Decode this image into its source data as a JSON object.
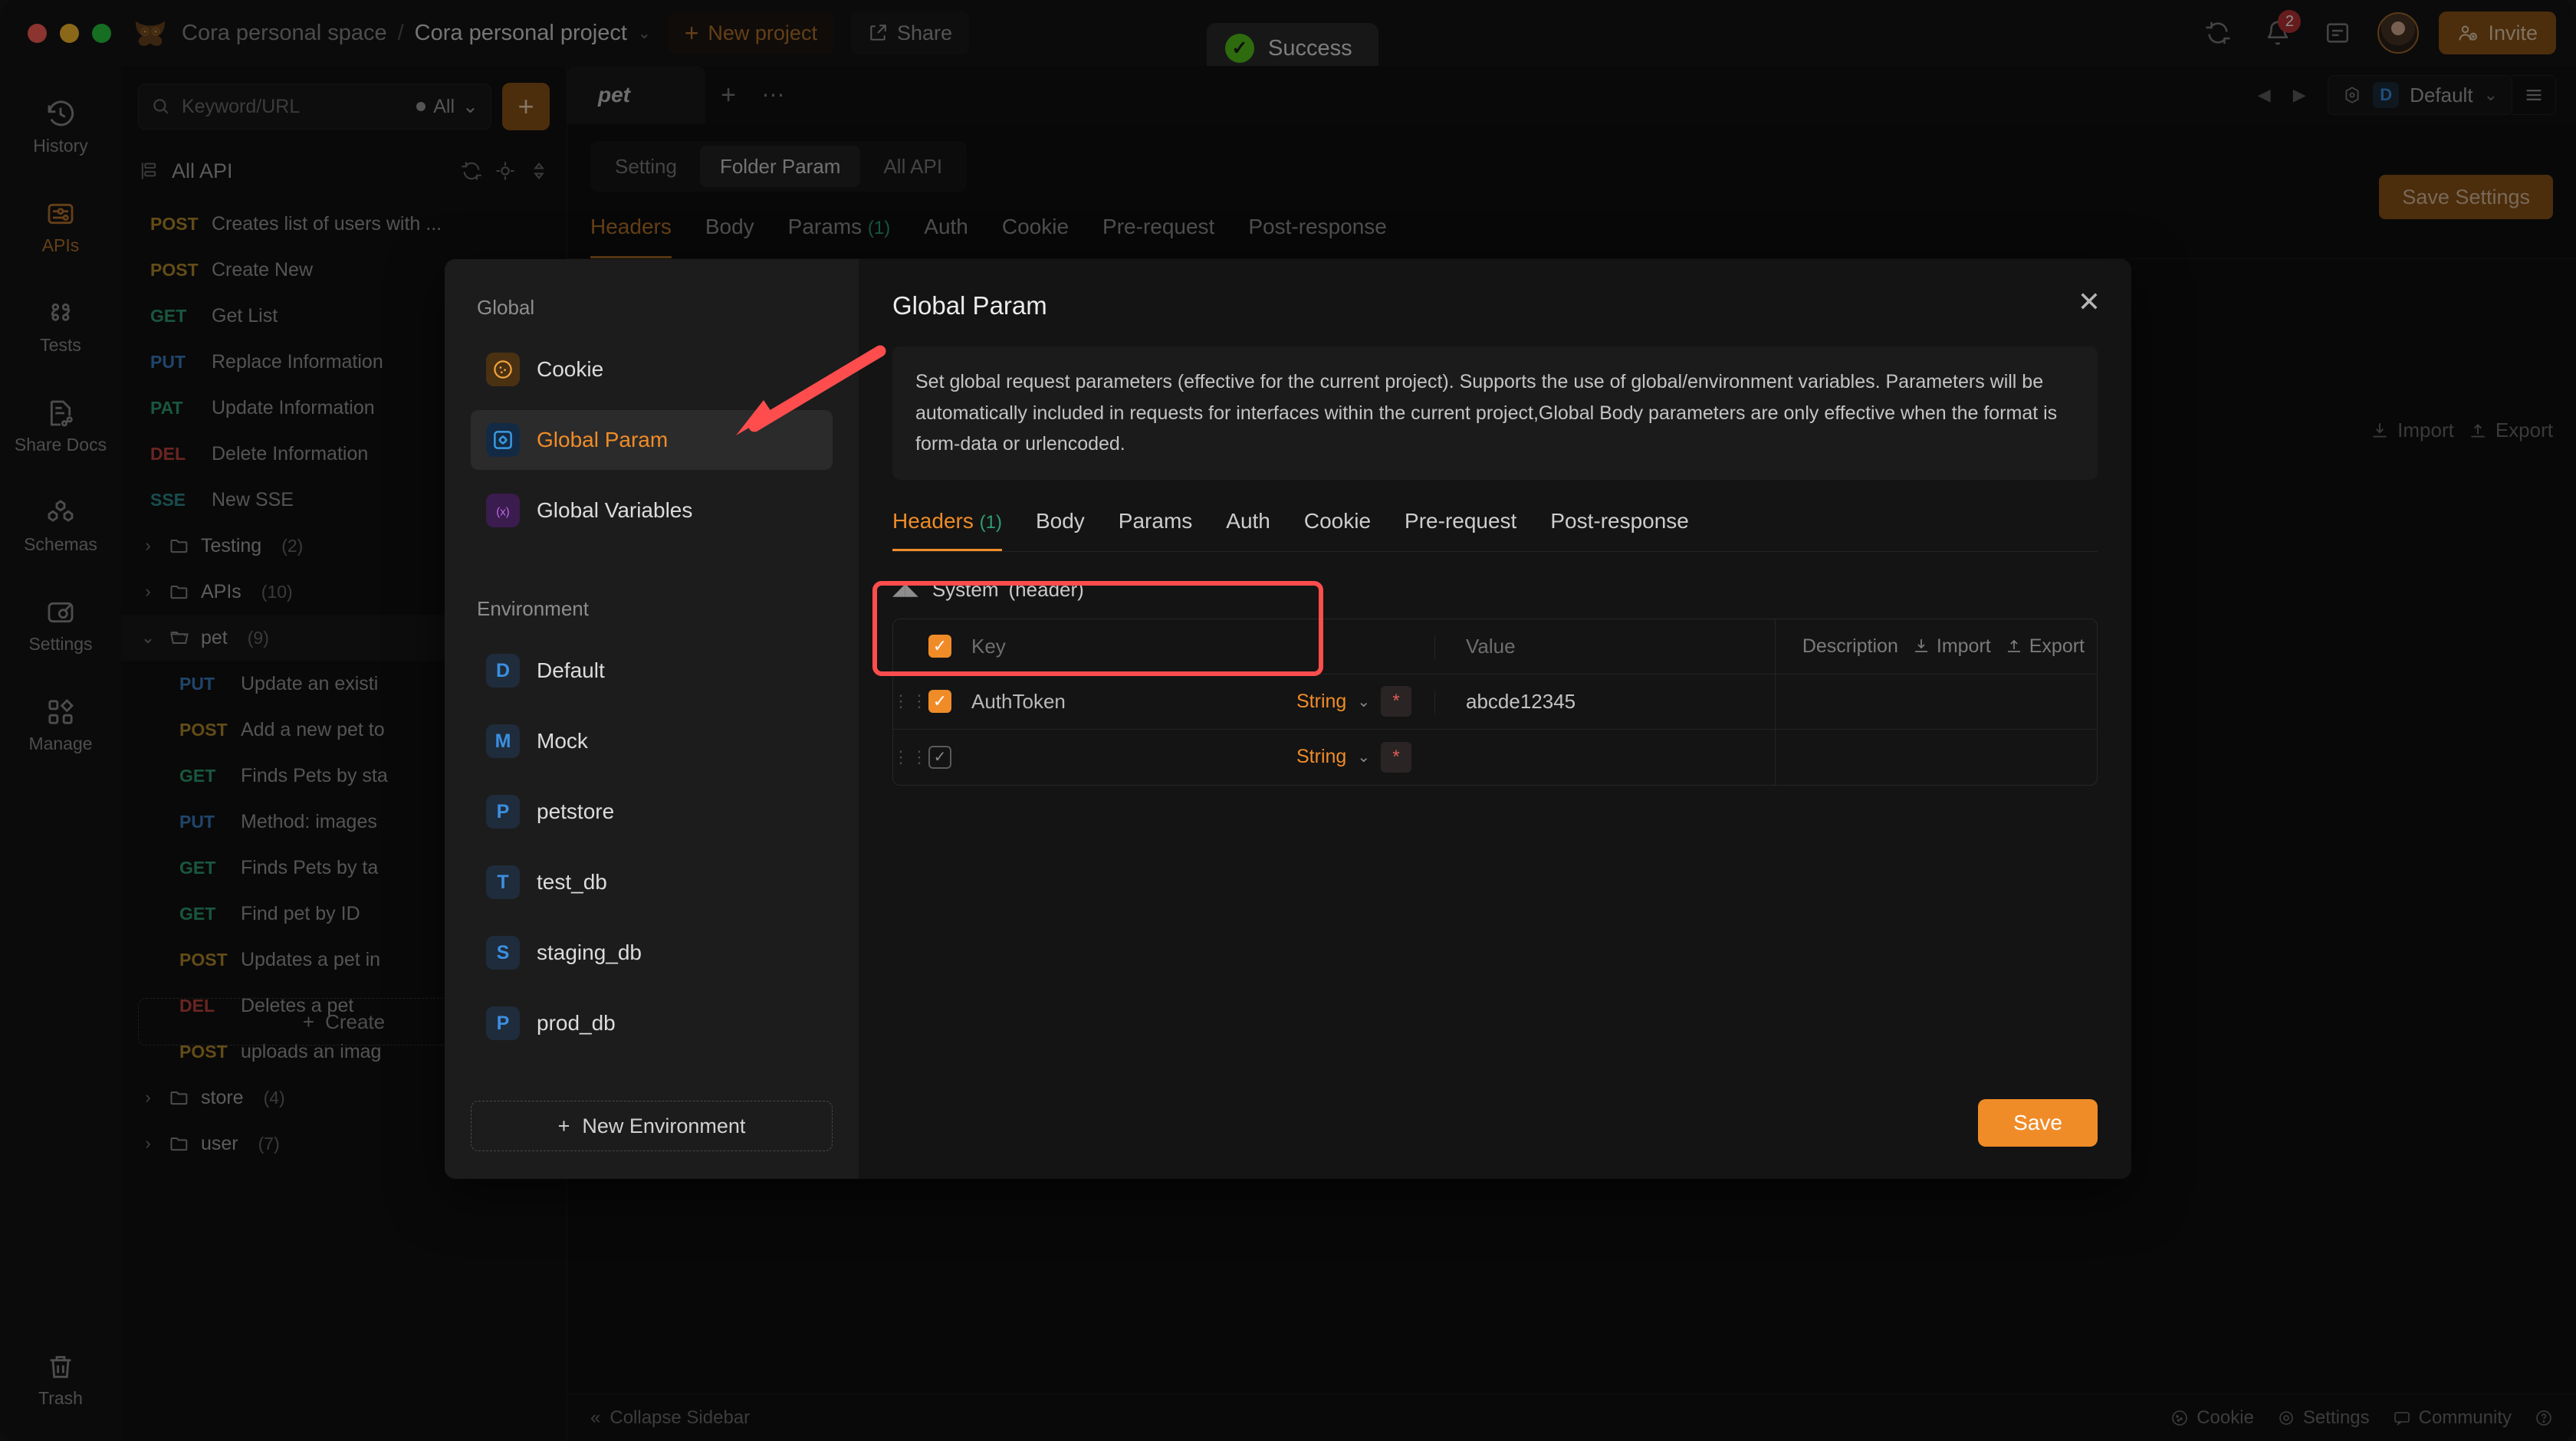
{
  "titlebar": {
    "space": "Cora personal space",
    "separator": "/",
    "project": "Cora personal project",
    "new_project": "New project",
    "share": "Share",
    "notification_count": "2",
    "invite": "Invite"
  },
  "toast": {
    "text": "Success"
  },
  "rail": {
    "items": [
      {
        "label": "History",
        "icon": "history-icon"
      },
      {
        "label": "APIs",
        "icon": "apis-icon"
      },
      {
        "label": "Tests",
        "icon": "tests-icon"
      },
      {
        "label": "Share Docs",
        "icon": "share-docs-icon"
      },
      {
        "label": "Schemas",
        "icon": "schemas-icon"
      },
      {
        "label": "Settings",
        "icon": "settings-icon"
      },
      {
        "label": "Manage",
        "icon": "manage-icon"
      }
    ],
    "trash": "Trash"
  },
  "list": {
    "search_placeholder": "Keyword/URL",
    "filter": "All",
    "add": "+",
    "all_api": "All API",
    "create": "Create",
    "rows": [
      {
        "kind": "api",
        "method": "POST",
        "mclass": "post",
        "name": "Creates list of users with ...",
        "indent": ""
      },
      {
        "kind": "api",
        "method": "POST",
        "mclass": "post",
        "name": "Create New",
        "indent": ""
      },
      {
        "kind": "api",
        "method": "GET",
        "mclass": "get",
        "name": "Get List",
        "indent": ""
      },
      {
        "kind": "api",
        "method": "PUT",
        "mclass": "put",
        "name": "Replace Information",
        "indent": ""
      },
      {
        "kind": "api",
        "method": "PAT",
        "mclass": "pat",
        "name": "Update Information",
        "indent": ""
      },
      {
        "kind": "api",
        "method": "DEL",
        "mclass": "del",
        "name": "Delete Information",
        "indent": ""
      },
      {
        "kind": "api",
        "method": "SSE",
        "mclass": "sse",
        "name": "New SSE",
        "indent": ""
      },
      {
        "kind": "folder",
        "chev": "›",
        "name": "Testing",
        "count": "(2)",
        "open": false,
        "selected": false
      },
      {
        "kind": "folder",
        "chev": "›",
        "name": "APIs",
        "count": "(10)",
        "open": false,
        "selected": false
      },
      {
        "kind": "folder",
        "chev": "⌄",
        "name": "pet",
        "count": "(9)",
        "open": true,
        "selected": true
      },
      {
        "kind": "api",
        "method": "PUT",
        "mclass": "put",
        "name": "Update an existi",
        "indent": "child"
      },
      {
        "kind": "api",
        "method": "POST",
        "mclass": "post",
        "name": "Add a new pet to",
        "indent": "child"
      },
      {
        "kind": "api",
        "method": "GET",
        "mclass": "get",
        "name": "Finds Pets by sta",
        "indent": "child"
      },
      {
        "kind": "api",
        "method": "PUT",
        "mclass": "put",
        "name": "Method: images",
        "indent": "child"
      },
      {
        "kind": "api",
        "method": "GET",
        "mclass": "get",
        "name": "Finds Pets by ta",
        "indent": "child"
      },
      {
        "kind": "api",
        "method": "GET",
        "mclass": "get",
        "name": "Find pet by ID",
        "indent": "child"
      },
      {
        "kind": "api",
        "method": "POST",
        "mclass": "post",
        "name": "Updates a pet in",
        "indent": "child"
      },
      {
        "kind": "api",
        "method": "DEL",
        "mclass": "del",
        "name": "Deletes a pet",
        "indent": "child"
      },
      {
        "kind": "api",
        "method": "POST",
        "mclass": "post",
        "name": "uploads an imag",
        "indent": "child"
      },
      {
        "kind": "folder",
        "chev": "›",
        "name": "store",
        "count": "(4)",
        "open": false,
        "selected": false
      },
      {
        "kind": "folder",
        "chev": "›",
        "name": "user",
        "count": "(7)",
        "open": false,
        "selected": false
      }
    ]
  },
  "main": {
    "doc_tab": "pet",
    "segments": [
      {
        "label": "Setting",
        "active": false
      },
      {
        "label": "Folder Param",
        "active": true
      },
      {
        "label": "All API",
        "active": false
      }
    ],
    "save_settings": "Save Settings",
    "env_selected": "Default",
    "env_initial": "D",
    "subtabs": [
      {
        "label": "Headers",
        "count": "",
        "active": true
      },
      {
        "label": "Body",
        "count": "",
        "active": false
      },
      {
        "label": "Params",
        "count": "(1)",
        "active": false
      },
      {
        "label": "Auth",
        "count": "",
        "active": false
      },
      {
        "label": "Cookie",
        "count": "",
        "active": false
      },
      {
        "label": "Pre-request",
        "count": "",
        "active": false
      },
      {
        "label": "Post-response",
        "count": "",
        "active": false
      }
    ],
    "import": "Import",
    "export": "Export"
  },
  "statusbar": {
    "collapse": "Collapse Sidebar",
    "cookie": "Cookie",
    "settings": "Settings",
    "community": "Community"
  },
  "modal": {
    "title": "Global Param",
    "close": "✕",
    "description": "Set global request parameters (effective for the current project). Supports the use of global/environment variables. Parameters will be automatically included in requests for interfaces within the current project,Global Body parameters are only effective when the format is form-data or urlencoded.",
    "global_label": "Global",
    "environment_label": "Environment",
    "global_items": [
      {
        "label": "Cookie",
        "icon": "cookie-icon",
        "sq": "cookie",
        "active": false
      },
      {
        "label": "Global Param",
        "icon": "global-param-icon",
        "sq": "gparam",
        "active": true
      },
      {
        "label": "Global Variables",
        "icon": "global-variables-icon",
        "sq": "gvar",
        "active": false
      }
    ],
    "environments": [
      {
        "label": "Default",
        "initial": "D"
      },
      {
        "label": "Mock",
        "initial": "M"
      },
      {
        "label": "petstore",
        "initial": "P"
      },
      {
        "label": "test_db",
        "initial": "T"
      },
      {
        "label": "staging_db",
        "initial": "S"
      },
      {
        "label": "prod_db",
        "initial": "P"
      }
    ],
    "new_environment": "New Environment",
    "tabs": [
      {
        "label": "Headers",
        "count": "(1)",
        "active": true
      },
      {
        "label": "Body",
        "count": "",
        "active": false
      },
      {
        "label": "Params",
        "count": "",
        "active": false
      },
      {
        "label": "Auth",
        "count": "",
        "active": false
      },
      {
        "label": "Cookie",
        "count": "",
        "active": false
      },
      {
        "label": "Pre-request",
        "count": "",
        "active": false
      },
      {
        "label": "Post-response",
        "count": "",
        "active": false
      }
    ],
    "section_title": "System (header)",
    "table": {
      "headers": {
        "key": "Key",
        "value": "Value",
        "description": "Description",
        "import": "Import",
        "export": "Export"
      },
      "rows": [
        {
          "checked": true,
          "key": "AuthToken",
          "type": "String",
          "value": "abcde12345",
          "required": "*"
        },
        {
          "checked": false,
          "key": "",
          "type": "String",
          "value": "",
          "required": "*"
        }
      ]
    },
    "save": "Save"
  },
  "colors": {
    "accent_orange": "#f08c28",
    "brand_brown": "#8a5216",
    "success_green": "#52c41a",
    "highlight_red": "#ff4d4d",
    "method_post": "#b58a2a",
    "method_get": "#2f9e73",
    "method_put": "#3b7fc4",
    "method_del": "#c2443c",
    "method_sse": "#2f8d8d"
  }
}
